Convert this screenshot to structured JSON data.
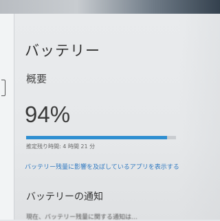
{
  "battery": {
    "title": "バッテリー",
    "overview_heading": "概要",
    "percent_text": "94%",
    "level_fraction": 0.94,
    "remaining_text": "推定残り時間: 4 時間 21 分",
    "link_text": "バッテリー残量に影響を及ぼしているアプリを表示する",
    "notify_heading": "バッテリーの通知",
    "notify_description": "現在、バッテリー残量に関する通知は…",
    "accent_color": "#2f8fd1"
  }
}
